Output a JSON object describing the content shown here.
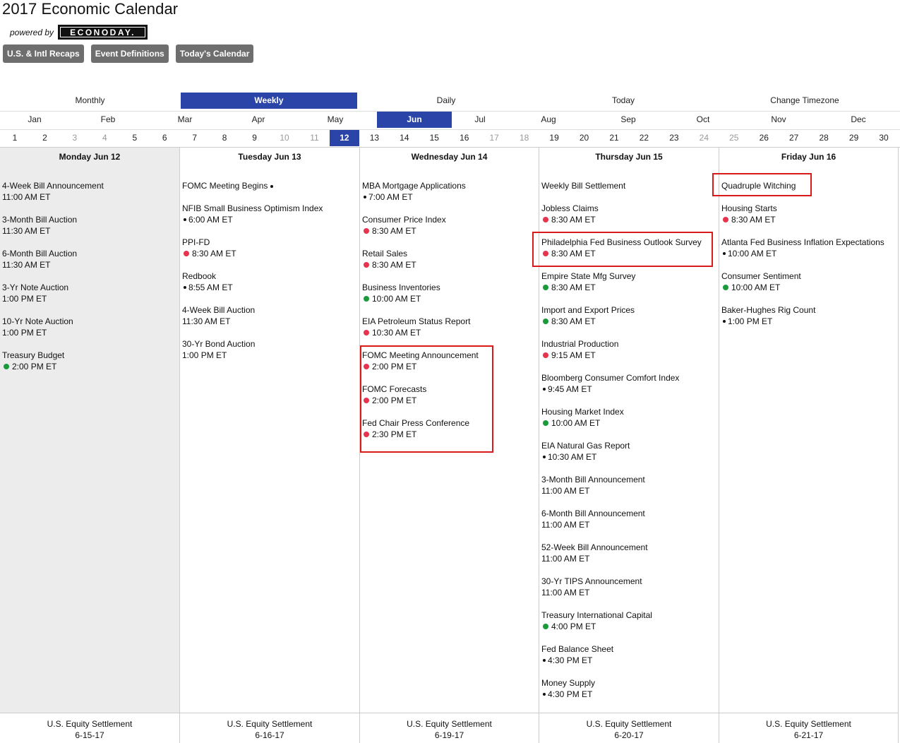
{
  "header": {
    "title": "2017 Economic Calendar",
    "powered_by": "powered by",
    "logo_text": "ECONODAY."
  },
  "buttons": [
    "U.S. & Intl Recaps",
    "Event Definitions",
    "Today's Calendar"
  ],
  "views": [
    {
      "label": "Monthly",
      "active": false
    },
    {
      "label": "Weekly",
      "active": true
    },
    {
      "label": "Daily",
      "active": false
    },
    {
      "label": "Today",
      "active": false
    },
    {
      "label": "Change Timezone",
      "active": false
    }
  ],
  "months": [
    {
      "label": "Jan",
      "active": false
    },
    {
      "label": "Feb",
      "active": false
    },
    {
      "label": "Mar",
      "active": false
    },
    {
      "label": "Apr",
      "active": false
    },
    {
      "label": "May",
      "active": false
    },
    {
      "label": "Jun",
      "active": true
    },
    {
      "label": "Jul",
      "active": false
    },
    {
      "label": "Aug",
      "active": false
    },
    {
      "label": "Sep",
      "active": false
    },
    {
      "label": "Oct",
      "active": false
    },
    {
      "label": "Nov",
      "active": false
    },
    {
      "label": "Dec",
      "active": false
    }
  ],
  "days": [
    {
      "n": "1"
    },
    {
      "n": "2"
    },
    {
      "n": "3",
      "weekend": true
    },
    {
      "n": "4",
      "weekend": true
    },
    {
      "n": "5"
    },
    {
      "n": "6"
    },
    {
      "n": "7"
    },
    {
      "n": "8"
    },
    {
      "n": "9"
    },
    {
      "n": "10",
      "weekend": true
    },
    {
      "n": "11",
      "weekend": true
    },
    {
      "n": "12",
      "active": true
    },
    {
      "n": "13"
    },
    {
      "n": "14"
    },
    {
      "n": "15"
    },
    {
      "n": "16"
    },
    {
      "n": "17",
      "weekend": true
    },
    {
      "n": "18",
      "weekend": true
    },
    {
      "n": "19"
    },
    {
      "n": "20"
    },
    {
      "n": "21"
    },
    {
      "n": "22"
    },
    {
      "n": "23"
    },
    {
      "n": "24",
      "weekend": true
    },
    {
      "n": "25",
      "weekend": true
    },
    {
      "n": "26"
    },
    {
      "n": "27"
    },
    {
      "n": "28"
    },
    {
      "n": "29"
    },
    {
      "n": "30"
    }
  ],
  "columns": [
    {
      "header": "Monday Jun 12",
      "shaded": true,
      "footer": {
        "label": "U.S. Equity Settlement",
        "date": "6-15-17"
      },
      "events": [
        {
          "name": "4-Week Bill Announcement",
          "time": "11:00 AM ET",
          "dot": ""
        },
        {
          "name": "3-Month Bill Auction",
          "time": "11:30 AM ET",
          "dot": ""
        },
        {
          "name": "6-Month Bill Auction",
          "time": "11:30 AM ET",
          "dot": ""
        },
        {
          "name": "3-Yr Note Auction",
          "time": "1:00 PM ET",
          "dot": ""
        },
        {
          "name": "10-Yr Note Auction",
          "time": "1:00 PM ET",
          "dot": ""
        },
        {
          "name": "Treasury Budget",
          "time": "2:00 PM ET",
          "dot": "green"
        }
      ]
    },
    {
      "header": "Tuesday Jun 13",
      "shaded": false,
      "footer": {
        "label": "U.S. Equity Settlement",
        "date": "6-16-17"
      },
      "events": [
        {
          "name": "FOMC Meeting Begins",
          "time": "",
          "dot": "",
          "inline_dot": "black",
          "compact": true
        },
        {
          "name": "NFIB Small Business Optimism Index",
          "time": "6:00 AM ET",
          "dot": "black"
        },
        {
          "name": "PPI-FD",
          "time": "8:30 AM ET",
          "dot": "red"
        },
        {
          "name": "Redbook",
          "time": "8:55 AM ET",
          "dot": "black"
        },
        {
          "name": "4-Week Bill Auction",
          "time": "11:30 AM ET",
          "dot": ""
        },
        {
          "name": "30-Yr Bond Auction",
          "time": "1:00 PM ET",
          "dot": ""
        }
      ]
    },
    {
      "header": "Wednesday Jun 14",
      "shaded": false,
      "footer": {
        "label": "U.S. Equity Settlement",
        "date": "6-19-17"
      },
      "events": [
        {
          "name": "MBA Mortgage Applications",
          "time": "7:00 AM ET",
          "dot": "black"
        },
        {
          "name": "Consumer Price Index",
          "time": "8:30 AM ET",
          "dot": "red"
        },
        {
          "name": "Retail Sales",
          "time": "8:30 AM ET",
          "dot": "red"
        },
        {
          "name": "Business Inventories",
          "time": "10:00 AM ET",
          "dot": "green"
        },
        {
          "name": "EIA Petroleum Status Report",
          "time": "10:30 AM ET",
          "dot": "red"
        },
        {
          "name": "FOMC Meeting Announcement",
          "time": "2:00 PM ET",
          "dot": "red"
        },
        {
          "name": "FOMC Forecasts",
          "time": "2:00 PM ET",
          "dot": "red"
        },
        {
          "name": "Fed Chair Press Conference",
          "time": "2:30 PM ET",
          "dot": "red"
        }
      ]
    },
    {
      "header": "Thursday Jun 15",
      "shaded": false,
      "footer": {
        "label": "U.S. Equity Settlement",
        "date": "6-20-17"
      },
      "events": [
        {
          "name": "Weekly Bill Settlement",
          "time": "",
          "dot": "",
          "compact": true
        },
        {
          "name": "Jobless Claims",
          "time": "8:30 AM ET",
          "dot": "red"
        },
        {
          "name": "Philadelphia Fed Business Outlook Survey",
          "time": "8:30 AM ET",
          "dot": "red"
        },
        {
          "name": "Empire State Mfg Survey",
          "time": "8:30 AM ET",
          "dot": "green"
        },
        {
          "name": "Import and Export Prices",
          "time": "8:30 AM ET",
          "dot": "green"
        },
        {
          "name": "Industrial Production",
          "time": "9:15 AM ET",
          "dot": "red"
        },
        {
          "name": "Bloomberg Consumer Comfort Index",
          "time": "9:45 AM ET",
          "dot": "black"
        },
        {
          "name": "Housing Market Index",
          "time": "10:00 AM ET",
          "dot": "green"
        },
        {
          "name": "EIA Natural Gas Report",
          "time": "10:30 AM ET",
          "dot": "black"
        },
        {
          "name": "3-Month Bill Announcement",
          "time": "11:00 AM ET",
          "dot": ""
        },
        {
          "name": "6-Month Bill Announcement",
          "time": "11:00 AM ET",
          "dot": ""
        },
        {
          "name": "52-Week Bill Announcement",
          "time": "11:00 AM ET",
          "dot": ""
        },
        {
          "name": "30-Yr TIPS Announcement",
          "time": "11:00 AM ET",
          "dot": ""
        },
        {
          "name": "Treasury International Capital",
          "time": "4:00 PM ET",
          "dot": "green"
        },
        {
          "name": "Fed Balance Sheet",
          "time": "4:30 PM ET",
          "dot": "black"
        },
        {
          "name": "Money Supply",
          "time": "4:30 PM ET",
          "dot": "black"
        }
      ]
    },
    {
      "header": "Friday Jun 16",
      "shaded": false,
      "footer": {
        "label": "U.S. Equity Settlement",
        "date": "6-21-17"
      },
      "events": [
        {
          "name": "Quadruple Witching",
          "time": "",
          "dot": "",
          "compact": true
        },
        {
          "name": "Housing Starts",
          "time": "8:30 AM ET",
          "dot": "red"
        },
        {
          "name": "Atlanta Fed Business Inflation Expectations",
          "time": "10:00 AM ET",
          "dot": "black"
        },
        {
          "name": "Consumer Sentiment",
          "time": "10:00 AM ET",
          "dot": "green"
        },
        {
          "name": "Baker-Hughes Rig Count",
          "time": "1:00 PM ET",
          "dot": "black"
        }
      ]
    }
  ],
  "colors": {
    "accent": "#2a44a8",
    "button_gray": "#6e6e6e",
    "high_importance": "#e8334e",
    "medium_importance": "#1a9a3a",
    "highlight_box": "#d91a1a",
    "shaded_column": "#ececec"
  }
}
